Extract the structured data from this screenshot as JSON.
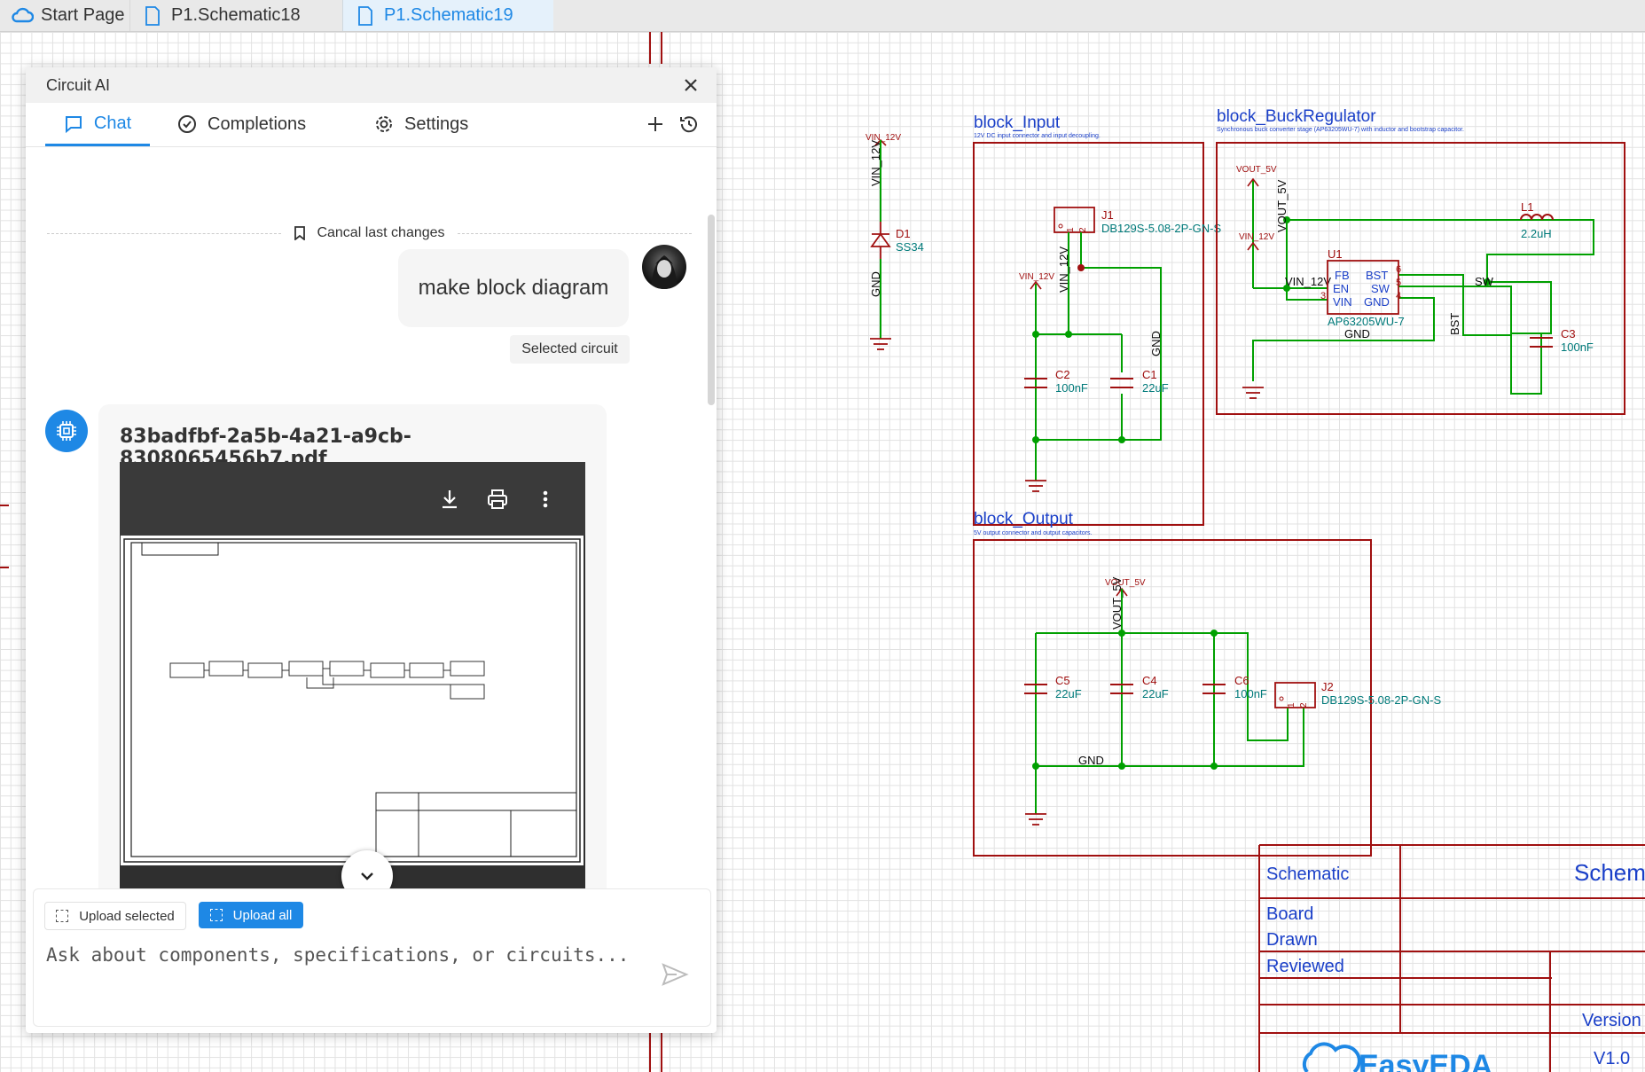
{
  "tabs": [
    {
      "label": "Start Page"
    },
    {
      "label": "P1.Schematic18"
    },
    {
      "label": "P1.Schematic19"
    }
  ],
  "ai_panel": {
    "title": "Circuit AI",
    "tabs": {
      "chat": "Chat",
      "completions": "Completions",
      "settings": "Settings"
    },
    "cancel_label": "Cancal last changes",
    "user_message": "make block diagram",
    "selected_chip": "Selected circuit",
    "pdf_filename": "83badfbf-2a5b-4a21-a9cb-8308065456b7.pdf",
    "upload_selected": "Upload selected",
    "upload_all": "Upload all",
    "input_placeholder": "Ask about components, specifications, or circuits..."
  },
  "schematic": {
    "colors": {
      "wire": "#00a000",
      "part": "#a01010",
      "text_blue": "#1a3fc8",
      "text_net": "#0a0a0a",
      "text_teal": "#007a7a"
    },
    "blocks": [
      {
        "name": "block_Input",
        "desc": "12V DC input connector and input decoupling."
      },
      {
        "name": "block_BuckRegulator",
        "desc": "Synchronous buck converter stage (AP63205WU-7) with inductor and bootstrap capacitor."
      },
      {
        "name": "block_Output",
        "desc": "5V output connector and output capacitors."
      }
    ],
    "standalone": {
      "net_vin": "VIN_12V",
      "vin_label": "VIN_12V",
      "gnd_label": "GND",
      "diode_ref": "D1",
      "diode_value": "SS34"
    },
    "input": {
      "j1_ref": "J1",
      "j1_value": "DB129S-5.08-2P-GN-S",
      "vin_label": "VIN_12V",
      "net_vin": "VIN_12V",
      "gnd_label": "GND",
      "c2_ref": "C2",
      "c2_value": "100nF",
      "c1_ref": "C1",
      "c1_value": "22uF"
    },
    "buck": {
      "net_vout": "VOUT_5V",
      "vout_label": "VOUT_5V",
      "net_vin": "VIN_12V",
      "vin_label": "VIN_12V",
      "u1_ref": "U1",
      "u1_value": "AP63205WU-7",
      "pin_fb": "FB",
      "pin_en": "EN",
      "pin_vin": "VIN",
      "pin_bst": "BST",
      "pin_sw": "SW",
      "pin_gnd": "GND",
      "pin6": "6",
      "pin5": "5",
      "pin4": "4",
      "pin3": "3",
      "l1_ref": "L1",
      "l1_value": "2.2uH",
      "sw_label": "SW",
      "bst_label": "BST",
      "c3_ref": "C3",
      "c3_value": "100nF",
      "gnd_label": "GND"
    },
    "output": {
      "net_vout": "VOUT_5V",
      "vout_label": "VOUT_5V",
      "gnd_label": "GND",
      "c5_ref": "C5",
      "c5_value": "22uF",
      "c4_ref": "C4",
      "c4_value": "22uF",
      "c6_ref": "C6",
      "c6_value": "100nF",
      "j2_ref": "J2",
      "j2_value": "DB129S-5.08-2P-GN-S"
    },
    "pin_labels": {
      "one": "1",
      "two": "2"
    }
  },
  "title_block": {
    "schematic": "Schematic",
    "schem_cut": "Schem",
    "board": "Board",
    "drawn": "Drawn",
    "reviewed": "Reviewed",
    "version": "Version",
    "version_value": "V1.0",
    "logo": "EasyEDA"
  }
}
